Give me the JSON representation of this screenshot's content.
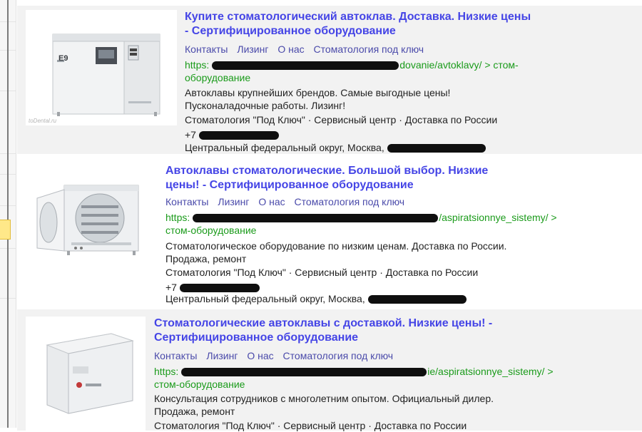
{
  "ads": [
    {
      "title": "Купите стоматологический автоклав. Доставка. Низкие цены - Сертифицированное оборудование",
      "sitelinks": [
        "Контакты",
        "Лизинг",
        "О нас",
        "Стоматология под ключ"
      ],
      "url_prefix": "https:",
      "url_suffix": "dovanie/avtoklavy/ > стом-оборудование",
      "description": "Автоклавы крупнейших брендов. Самые выгодные цены! Пусконаладочные работы. Лизинг!",
      "meta": "Стоматология \"Под Ключ\" · Сервисный центр · Доставка по России",
      "phone": "+7",
      "address": "Центральный федеральный округ, Москва,",
      "image_label": "E9",
      "watermark": "toDental.ru"
    },
    {
      "title": "Автоклавы стоматологические. Большой выбор. Низкие цены! - Сертифицированное оборудование",
      "sitelinks": [
        "Контакты",
        "Лизинг",
        "О нас",
        "Стоматология под ключ"
      ],
      "url_prefix": "https:",
      "url_suffix": "/aspiratsionnye_sistemy/ > стом-оборудование",
      "description": "Стоматологическое оборудование по низким ценам. Доставка по России. Продажа, ремонт",
      "meta": "Стоматология \"Под Ключ\" · Сервисный центр · Доставка по России",
      "phone": "+7",
      "address": "Центральный федеральный округ, Москва,"
    },
    {
      "title": "Стоматологические автоклавы с доставкой. Низкие цены! - Сертифицированное оборудование",
      "sitelinks": [
        "Контакты",
        "Лизинг",
        "О нас",
        "Стоматология под ключ"
      ],
      "url_prefix": "https:",
      "url_suffix": "ie/aspiratsionnye_sistemy/ > стом-оборудование",
      "description": "Консультация сотрудников с многолетним опытом. Официальный дилер. Продажа, ремонт",
      "meta": "Стоматология \"Под Ключ\" · Сервисный центр · Доставка по России"
    }
  ],
  "colors": {
    "title_link": "#4545e6",
    "sitelink": "#4a4aaa",
    "url": "#1b9b1b",
    "row_background": "#f2f2f2"
  }
}
